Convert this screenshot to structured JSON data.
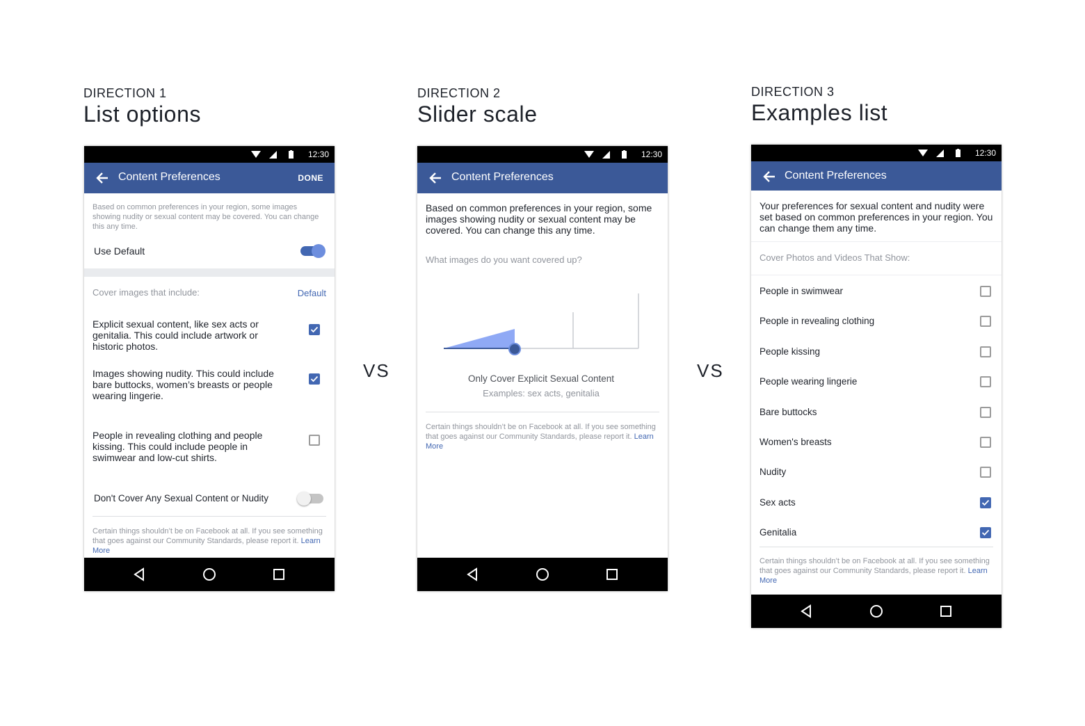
{
  "directions": [
    {
      "label": "DIRECTION 1",
      "title": "List options"
    },
    {
      "label": "DIRECTION 2",
      "title": "Slider scale"
    },
    {
      "label": "DIRECTION 3",
      "title": "Examples list"
    }
  ],
  "vs_label": "VS",
  "status_time": "12:30",
  "appbar_title": "Content Preferences",
  "done_label": "DONE",
  "footer": {
    "text": "Certain things shouldn’t be on Facebook at all. If you see something that goes against our Community Standards, please report it.",
    "link": "Learn More"
  },
  "phone1": {
    "intro": "Based on common preferences in your region, some images showing nudity or sexual content may be covered. You can change this any time.",
    "use_default": {
      "label": "Use Default",
      "on": true
    },
    "section_label": "Cover images that include:",
    "default_link": "Default",
    "options": [
      {
        "text": "Explicit sexual content, like sex acts or genitalia. This could include artwork or historic photos.",
        "checked": true
      },
      {
        "text": "Images showing nudity. This could include bare buttocks, women’s breasts or people wearing lingerie.",
        "checked": true
      },
      {
        "text": "People in revealing clothing and people kissing. This could include people in swimwear and low-cut shirts.",
        "checked": false
      }
    ],
    "dont_cover": {
      "label": "Don't Cover Any Sexual Content or Nudity",
      "on": false
    }
  },
  "phone2": {
    "intro": "Based on common preferences in your region, some images showing nudity or sexual content may be covered. You can change this any time.",
    "question": "What images do you want covered up?",
    "slider_position": "1 of 4",
    "selection_title": "Only Cover Explicit Sexual Content",
    "selection_examples": "Examples: sex acts, genitalia"
  },
  "phone3": {
    "intro": "Your preferences for sexual content and nudity were set based on common preferences in your region. You can change them any time.",
    "section_label": "Cover Photos and Videos That Show:",
    "items": [
      {
        "label": "People in swimwear",
        "checked": false
      },
      {
        "label": "People in revealing clothing",
        "checked": false
      },
      {
        "label": "People kissing",
        "checked": false
      },
      {
        "label": "People wearing lingerie",
        "checked": false
      },
      {
        "label": "Bare buttocks",
        "checked": false
      },
      {
        "label": "Women's breasts",
        "checked": false
      },
      {
        "label": "Nudity",
        "checked": false
      },
      {
        "label": "Sex acts",
        "checked": true
      },
      {
        "label": "Genitalia",
        "checked": true
      }
    ]
  },
  "colors": {
    "brand": "#3b5998",
    "accent": "#4267b2",
    "slider_fill": "#8fa9f5"
  },
  "icons": {
    "back": "arrow-left-icon",
    "nav_back": "triangle-back-icon",
    "nav_home": "circle-home-icon",
    "nav_recent": "square-recent-icon"
  }
}
